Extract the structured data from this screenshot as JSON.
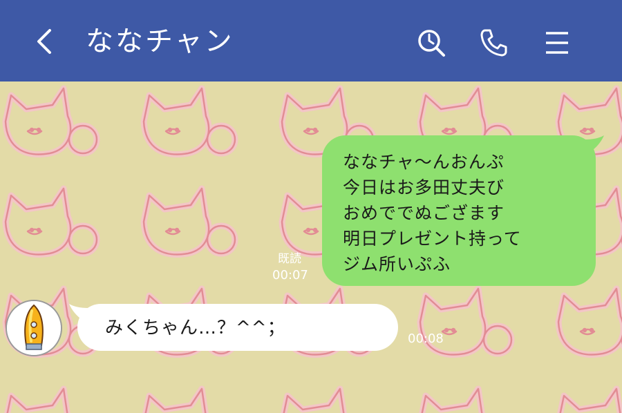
{
  "header": {
    "back_icon": "chevron-left-icon",
    "title": "ななチャン",
    "search_icon": "search-icon",
    "phone_icon": "phone-icon",
    "menu_icon": "menu-icon",
    "background_color": "#3e59a6"
  },
  "chat": {
    "background_color": "#e3dba7",
    "messages": [
      {
        "direction": "outgoing",
        "lines": [
          "ななチャ～んおんぷ",
          "今日はお多田丈夫び",
          "おめででぬござます",
          "明日プレゼント持って",
          "ジム所いぷふ"
        ],
        "read_label": "既読",
        "time": "00:07",
        "bubble_color": "#8ee06f"
      },
      {
        "direction": "incoming",
        "text": "みくちゃん…？^^；",
        "time": "00:08",
        "bubble_color": "#ffffff",
        "avatar": "rocket-avatar"
      }
    ]
  }
}
